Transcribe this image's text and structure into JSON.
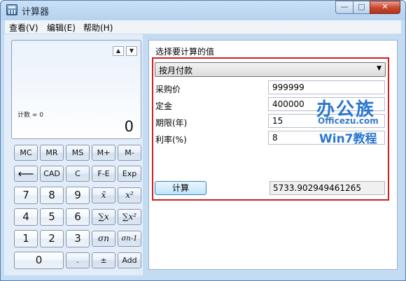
{
  "window": {
    "title": "计算器",
    "buttons": {
      "minimize": "—",
      "maximize": "□",
      "close": "✕"
    }
  },
  "menu": {
    "view": "查看(V)",
    "edit": "编辑(E)",
    "help": "帮助(H)"
  },
  "display": {
    "memory_label": "计数 = 0",
    "value": "0",
    "history_up": "▲",
    "history_down": "▼"
  },
  "keypad": {
    "mc": "MC",
    "mr": "MR",
    "ms": "MS",
    "mplus": "M+",
    "mminus": "M-",
    "backspace": "⟵",
    "cad": "CAD",
    "c": "C",
    "fe": "F-E",
    "exp": "Exp",
    "n7": "7",
    "n8": "8",
    "n9": "9",
    "xbar": "x̄",
    "xbar2": "x²",
    "n4": "4",
    "n5": "5",
    "n6": "6",
    "sumx": "∑x",
    "sumx2": "∑x²",
    "n1": "1",
    "n2": "2",
    "n3": "3",
    "sigman": "σn",
    "sigman1": "σn-1",
    "n0": "0",
    "dot": ".",
    "plusminus": "±",
    "add": "Add"
  },
  "worksheet": {
    "title": "选择要计算的值",
    "mode": "按月付款",
    "mode_arrow": "▼",
    "fields": [
      {
        "label": "采购价",
        "value": "999999"
      },
      {
        "label": "定金",
        "value": "400000"
      },
      {
        "label": "期限(年)",
        "value": "15"
      },
      {
        "label": "利率(%)",
        "value": "8"
      }
    ],
    "calculate_label": "计算",
    "result": "5733.902949461265"
  },
  "watermark": {
    "line1": "办公族",
    "line2": "Officezu.com",
    "line3": "Win7教程"
  },
  "colors": {
    "highlight_frame": "#d21e1e",
    "window_frame": "#c3dbf3"
  }
}
